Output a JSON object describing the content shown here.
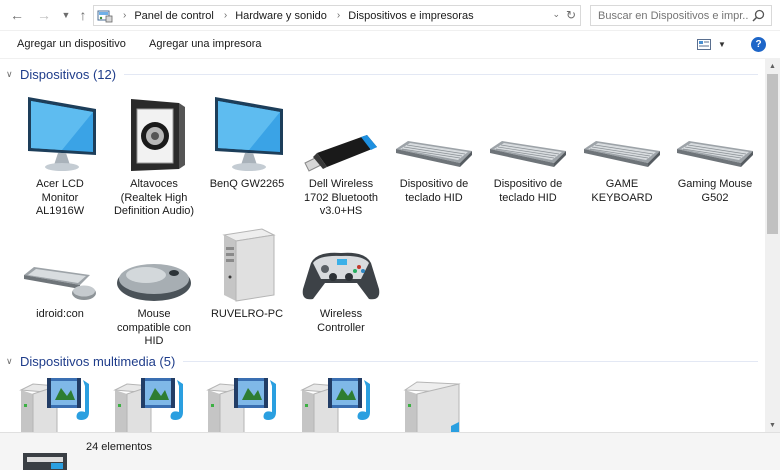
{
  "address_bar": {
    "breadcrumb": [
      "Panel de control",
      "Hardware y sonido",
      "Dispositivos e impresoras"
    ],
    "search_placeholder": "Buscar en Dispositivos e impr..."
  },
  "command_bar": {
    "add_device": "Agregar un dispositivo",
    "add_printer": "Agregar una impresora",
    "help": "?"
  },
  "groups": [
    {
      "title": "Dispositivos (12)",
      "devices": [
        {
          "label": "Acer LCD Monitor AL1916W",
          "icon": "monitor-icon"
        },
        {
          "label": "Altavoces (Realtek High Definition Audio)",
          "icon": "speaker-icon"
        },
        {
          "label": "BenQ GW2265",
          "icon": "monitor-icon"
        },
        {
          "label": "Dell Wireless 1702 Bluetooth v3.0+HS",
          "icon": "usb-adapter-icon"
        },
        {
          "label": "Dispositivo de teclado HID",
          "icon": "keyboard-icon"
        },
        {
          "label": "Dispositivo de teclado HID",
          "icon": "keyboard-icon"
        },
        {
          "label": "GAME KEYBOARD",
          "icon": "keyboard-icon"
        },
        {
          "label": "Gaming Mouse G502",
          "icon": "keyboard-icon"
        },
        {
          "label": "idroid:con",
          "icon": "keyboard-mouse-icon"
        },
        {
          "label": "Mouse compatible con HID",
          "icon": "mouse-icon"
        },
        {
          "label": "RUVELRO-PC",
          "icon": "computer-icon"
        },
        {
          "label": "Wireless Controller",
          "icon": "gamepad-icon"
        }
      ]
    },
    {
      "title": "Dispositivos multimedia (5)",
      "devices": [
        {
          "label": "",
          "icon": "media-device-icon"
        },
        {
          "label": "",
          "icon": "media-device-icon"
        },
        {
          "label": "",
          "icon": "media-device-icon"
        },
        {
          "label": "",
          "icon": "media-device-icon"
        },
        {
          "label": "",
          "icon": "media-server-icon"
        }
      ]
    }
  ],
  "status": {
    "count": "24 elementos"
  },
  "colors": {
    "group_title": "#1e3c8a",
    "help_button": "#1e66c8",
    "monitor_screen": "#3aa3e6"
  }
}
